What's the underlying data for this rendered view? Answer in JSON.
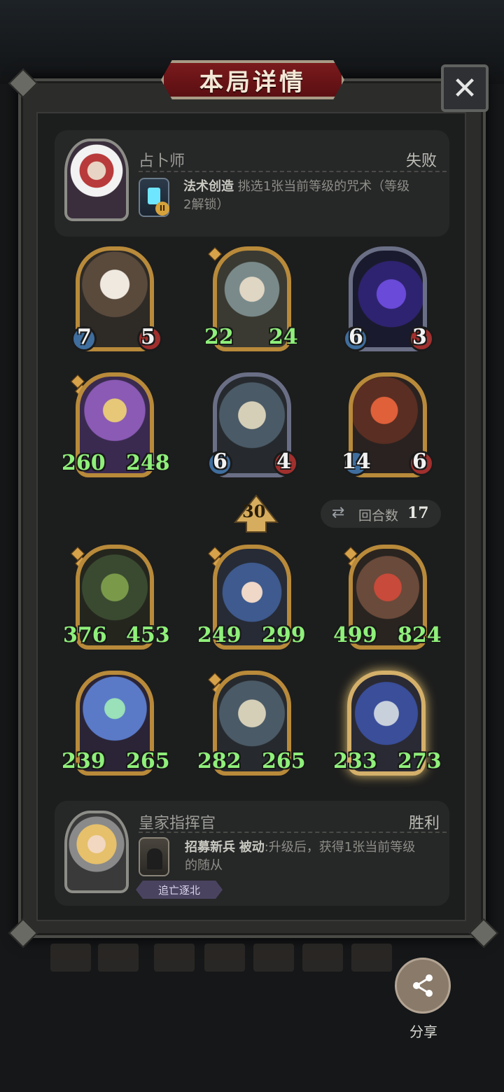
{
  "dialog": {
    "title": "本局详情",
    "close_icon": "close-icon"
  },
  "opponent": {
    "name": "占卜师",
    "result": "失败",
    "skill_name": "法术创造",
    "skill_desc_line1": "挑选1张当前等级的咒术（等级",
    "skill_desc_line2": "2解锁）",
    "skill_icon": "lantern-icon",
    "skill_icon_badge": "II"
  },
  "opponent_cards": [
    {
      "atk": "7",
      "hp": "5"
    },
    {
      "atk": "22",
      "hp": "24"
    },
    {
      "atk": "6",
      "hp": "3"
    },
    {
      "atk": "260",
      "hp": "248"
    },
    {
      "atk": "6",
      "hp": "4"
    },
    {
      "atk": "14",
      "hp": "6"
    }
  ],
  "match": {
    "level": "30",
    "rounds_label": "回合数",
    "rounds_value": "17"
  },
  "player_cards": [
    {
      "atk": "376",
      "hp": "453"
    },
    {
      "atk": "249",
      "hp": "299"
    },
    {
      "atk": "499",
      "hp": "824"
    },
    {
      "atk": "239",
      "hp": "265"
    },
    {
      "atk": "282",
      "hp": "265"
    },
    {
      "atk": "233",
      "hp": "273"
    }
  ],
  "player": {
    "name": "皇家指挥官",
    "result": "胜利",
    "skill_name": "招募新兵",
    "skill_type": "被动",
    "skill_desc_line1": ":升级后，获得1张当前等级",
    "skill_desc_line2": "的随从",
    "tag": "追亡逐北"
  },
  "share": {
    "label": "分享"
  },
  "colors": {
    "title_red": "#6e161a",
    "stat_green": "#8ff07a",
    "gold_border": "#b88a3a"
  }
}
